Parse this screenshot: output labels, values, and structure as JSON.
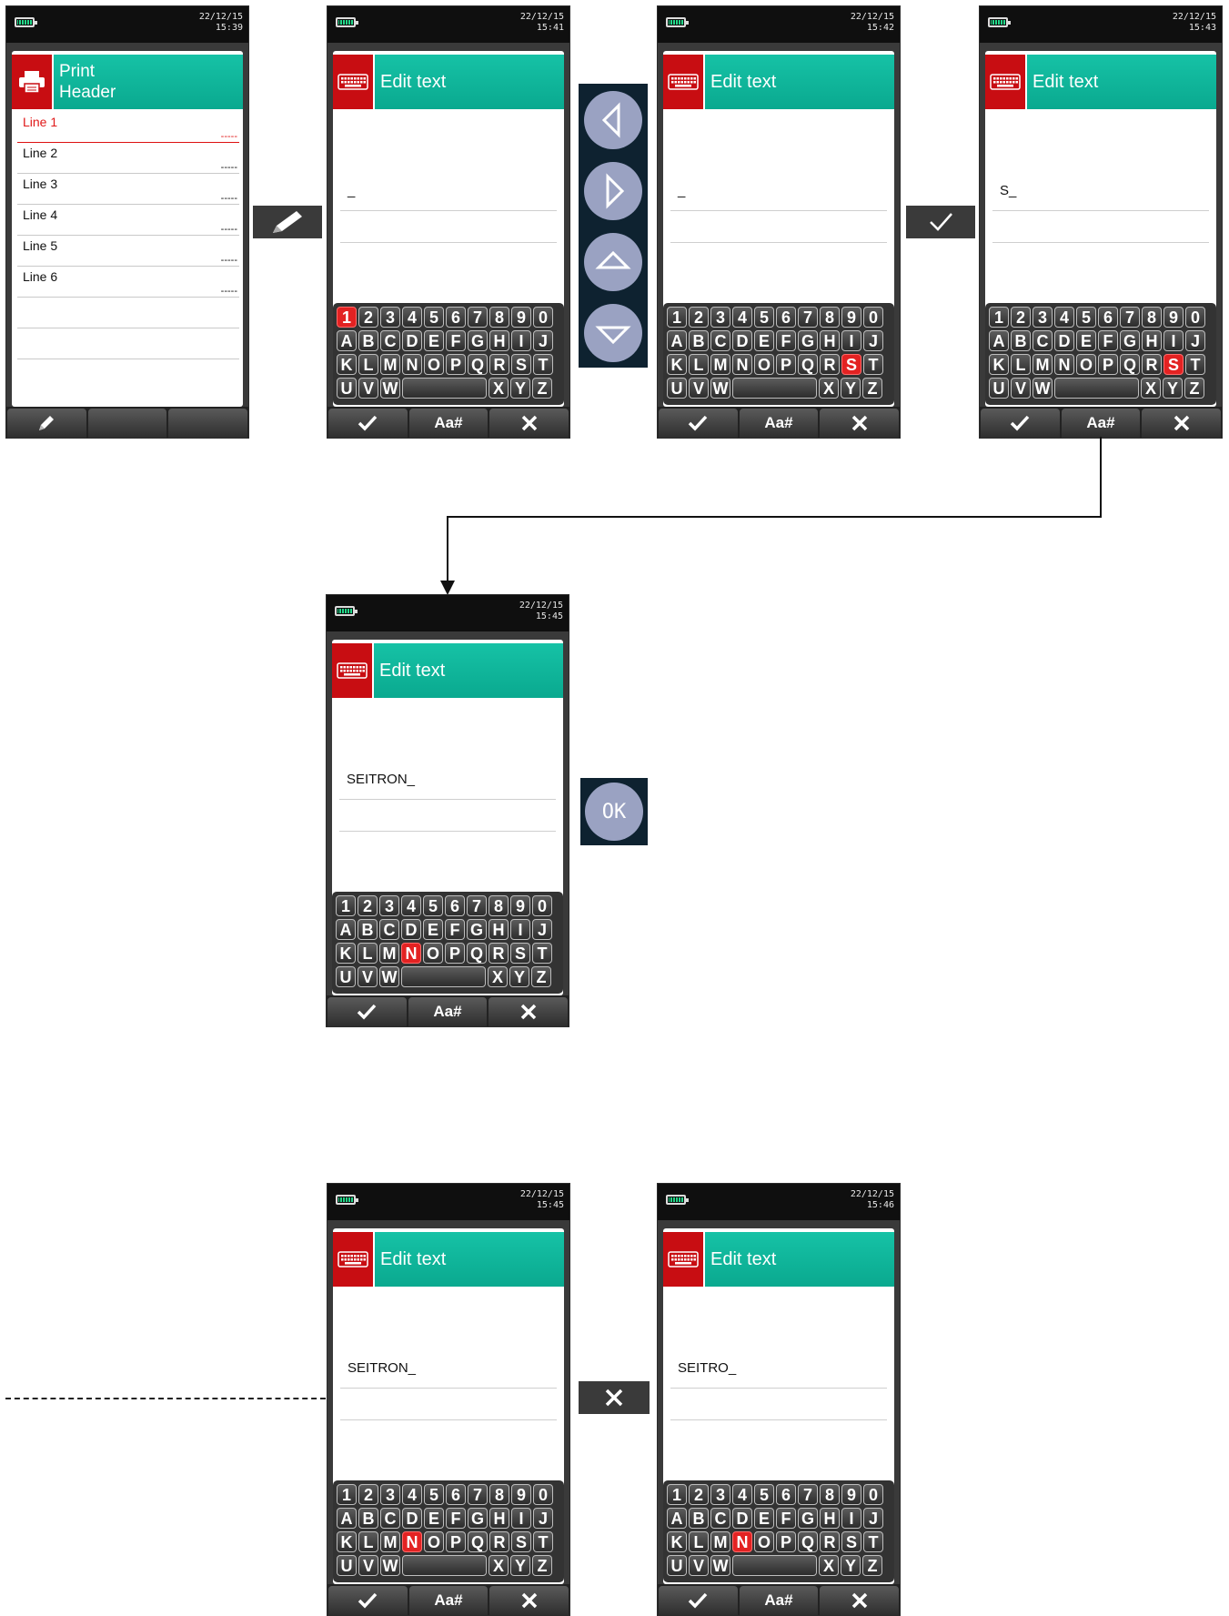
{
  "status": {
    "s1": {
      "date": "22/12/15",
      "time": "15:39"
    },
    "s2": {
      "date": "22/12/15",
      "time": "15:41"
    },
    "s3": {
      "date": "22/12/15",
      "time": "15:42"
    },
    "s4": {
      "date": "22/12/15",
      "time": "15:43"
    },
    "s5": {
      "date": "22/12/15",
      "time": "15:45"
    },
    "s6": {
      "date": "22/12/15",
      "time": "15:45"
    },
    "s7": {
      "date": "22/12/15",
      "time": "15:46"
    }
  },
  "print_header": {
    "title_line1": "Print",
    "title_line2": "Header",
    "lines": [
      {
        "label": "Line 1",
        "value": "-----"
      },
      {
        "label": "Line 2",
        "value": "-----"
      },
      {
        "label": "Line 3",
        "value": "-----"
      },
      {
        "label": "Line 4",
        "value": "-----"
      },
      {
        "label": "Line 5",
        "value": "-----"
      },
      {
        "label": "Line 6",
        "value": "-----"
      }
    ],
    "selected_line": 1
  },
  "edit": {
    "title": "Edit text",
    "s2_value": "_",
    "s3_value": "_",
    "s4_value": "S_",
    "s5_value": "SEITRON_",
    "s6_value": "SEITRON_",
    "s7_value": "SEITRO_"
  },
  "keyboard": {
    "row1": [
      "1",
      "2",
      "3",
      "4",
      "5",
      "6",
      "7",
      "8",
      "9",
      "0"
    ],
    "row2": [
      "A",
      "B",
      "C",
      "D",
      "E",
      "F",
      "G",
      "H",
      "I",
      "J"
    ],
    "row3": [
      "K",
      "L",
      "M",
      "N",
      "O",
      "P",
      "Q",
      "R",
      "S",
      "T"
    ],
    "row4": [
      "U",
      "V",
      "W",
      "",
      "X",
      "Y",
      "Z"
    ]
  },
  "highlight": {
    "s2": "1",
    "s3": "S",
    "s4": "S",
    "s5": "N",
    "s6": "N",
    "s7": "N"
  },
  "bottom_bar": {
    "case_label": "Aa#"
  },
  "controls": {
    "ok_label": "OK"
  },
  "colors": {
    "accent_teal": "#0fb79b",
    "header_red": "#c80d12",
    "key_highlight": "#e32222",
    "nav_dark": "#0e2230",
    "nav_circle": "#9aa2c2"
  }
}
